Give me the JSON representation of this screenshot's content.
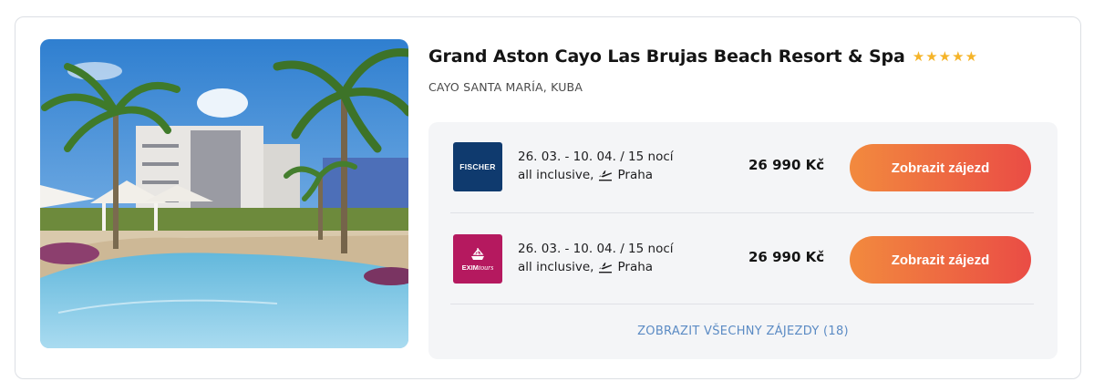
{
  "hotel": {
    "name": "Grand Aston Cayo Las Brujas Beach Resort & Spa",
    "stars": "★★★★★",
    "location": "CAYO SANTA MARÍA, KUBA"
  },
  "offers": [
    {
      "operator": "FISCHER",
      "dates": "26. 03. - 10. 04. / 15 nocí",
      "board": "all inclusive,",
      "departure": "Praha",
      "price": "26 990 Kč",
      "button": "Zobrazit zájezd"
    },
    {
      "operator": "EXIM",
      "operator_suffix": "tours",
      "dates": "26. 03. - 10. 04. / 15 nocí",
      "board": "all inclusive,",
      "departure": "Praha",
      "price": "26 990 Kč",
      "button": "Zobrazit zájezd"
    }
  ],
  "show_all": "ZOBRAZIT VŠECHNY ZÁJEZDY (18)",
  "colors": {
    "accent_start": "#f28a3e",
    "accent_end": "#ea4c45",
    "link": "#5b8bc4",
    "stars": "#f5b429",
    "fischer": "#0f3a6e",
    "exim": "#b5195f"
  },
  "icons": [
    "star-icon",
    "plane-departure-icon",
    "fischer-logo",
    "exim-tours-logo"
  ]
}
